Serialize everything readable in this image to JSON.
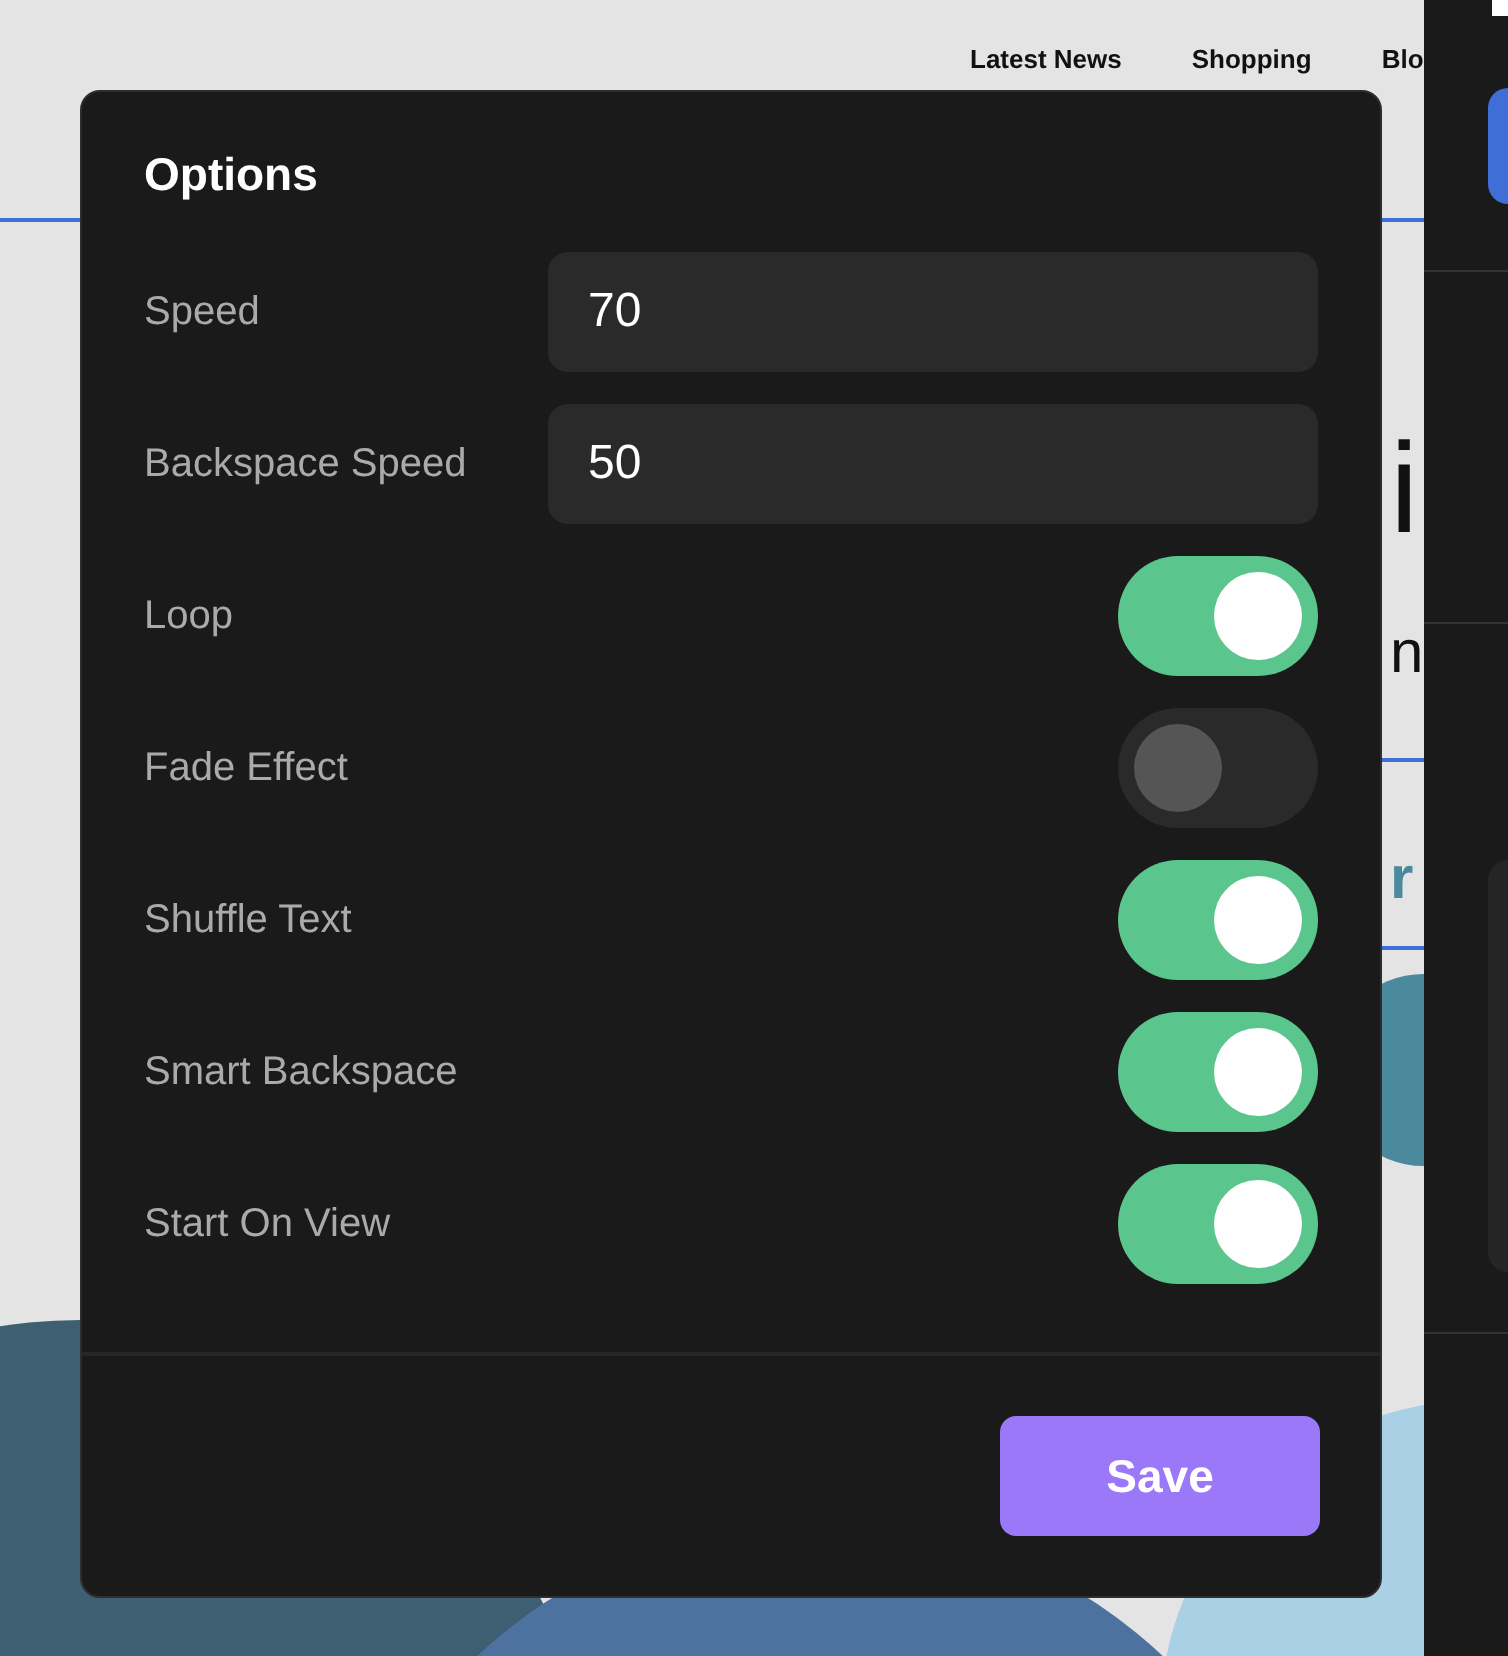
{
  "nav": [
    {
      "label": "Latest News"
    },
    {
      "label": "Shopping"
    },
    {
      "label": "Blo"
    }
  ],
  "background_text": [
    {
      "text": "i",
      "kind": "dark"
    },
    {
      "text": "n",
      "kind": "dark"
    },
    {
      "text": "r",
      "kind": "teal"
    }
  ],
  "dialog": {
    "title": "Options",
    "fields": [
      {
        "kind": "number",
        "label": "Speed",
        "value": "70"
      },
      {
        "kind": "number",
        "label": "Backspace Speed",
        "value": "50"
      },
      {
        "kind": "toggle",
        "label": "Loop",
        "on": true
      },
      {
        "kind": "toggle",
        "label": "Fade Effect",
        "on": false
      },
      {
        "kind": "toggle",
        "label": "Shuffle Text",
        "on": true
      },
      {
        "kind": "toggle",
        "label": "Smart Backspace",
        "on": true
      },
      {
        "kind": "toggle",
        "label": "Start On View",
        "on": true
      }
    ],
    "buttons": [
      {
        "label": "Save"
      }
    ]
  }
}
